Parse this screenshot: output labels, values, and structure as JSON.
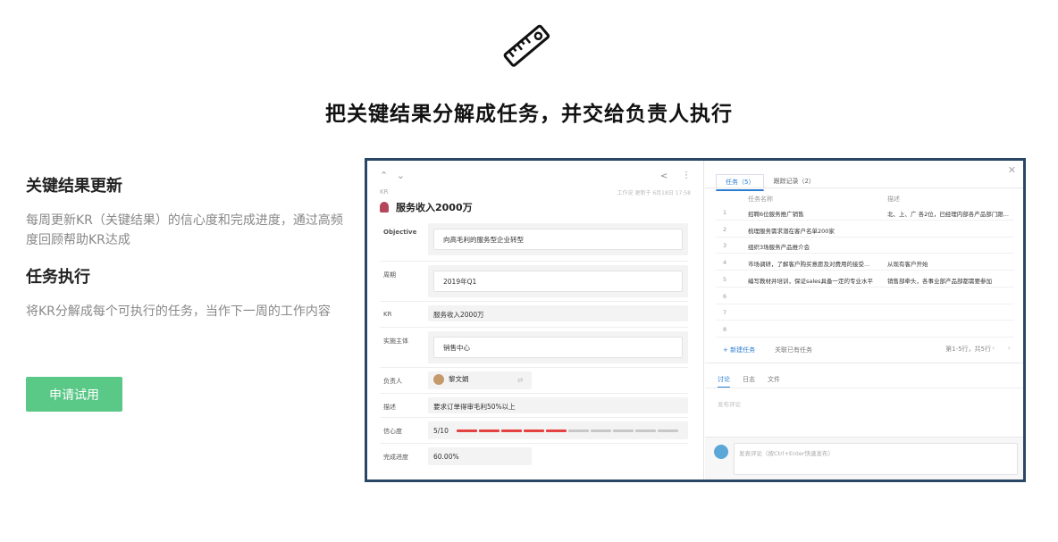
{
  "hero": {
    "icon": "ruler-icon",
    "title": "把关键结果分解成任务，并交给负责人执行"
  },
  "left": {
    "section1_title": "关键结果更新",
    "section1_desc": "每周更新KR（关键结果）的信心度和完成进度，通过高频度回顾帮助KR达成",
    "section2_title": "任务执行",
    "section2_desc": "将KR分解成每个可执行的任务，当作下一周的工作内容",
    "cta_label": "申请试用"
  },
  "colors": {
    "accent_green": "#5ac887",
    "link_blue": "#2b7cd3",
    "confidence_red": "#e54242"
  },
  "kr_panel": {
    "nav_arrows": "⌃ ⌄",
    "kr_small": "KR",
    "updated": "工作说 更新于 6月18日 17:58",
    "title": "服务收入2000万",
    "objective_label": "Objective",
    "objective_value": "向高毛利的服务型企业转型",
    "period_label": "周期",
    "period_value": "2019年Q1",
    "kr_label": "KR",
    "kr_value": "服务收入2000万",
    "owner_entity_label": "实施主体",
    "owner_entity_value": "销售中心",
    "owner_label": "负责人",
    "owner_value": "黎文娟",
    "desc_label": "描述",
    "desc_value": "要求订单得审毛利50%以上",
    "confidence_label": "信心度",
    "confidence_value": "5/10",
    "confidence_level": 5,
    "confidence_max": 10,
    "progress_label": "完成进度",
    "progress_value": "60.00%"
  },
  "task_panel": {
    "tab_tasks": "任务（5）",
    "tab_records": "跟踪记录（2）",
    "col_name": "任务名称",
    "col_desc": "描述",
    "rows": [
      {
        "num": "1",
        "name": "招聘6位服务推广销售",
        "desc": "北、上、广 各2位，已经理内部各产品部门跟..."
      },
      {
        "num": "2",
        "name": "梳理服务需求潜在客户名单200家",
        "desc": ""
      },
      {
        "num": "3",
        "name": "组织3场服务产品推介会",
        "desc": ""
      },
      {
        "num": "4",
        "name": "市场调研，了解客户购买意愿及对费用的接受...",
        "desc": "从现有客户开始"
      },
      {
        "num": "5",
        "name": "编写教材并培训，保证sales具备一定的专业水平",
        "desc": "销售部牵头，各事业部产品部都需要参加"
      },
      {
        "num": "6",
        "name": "",
        "desc": ""
      },
      {
        "num": "7",
        "name": "",
        "desc": ""
      },
      {
        "num": "8",
        "name": "",
        "desc": ""
      }
    ],
    "new_task": "+ 新建任务",
    "link_task": "关联已有任务",
    "pager": "第1-5行，共5行",
    "subtab_discuss": "讨论",
    "subtab_log": "日志",
    "subtab_files": "文件",
    "post_hint": "发布评论",
    "comment_placeholder": "发表评论（按Ctrl+Enter快速发布）"
  }
}
